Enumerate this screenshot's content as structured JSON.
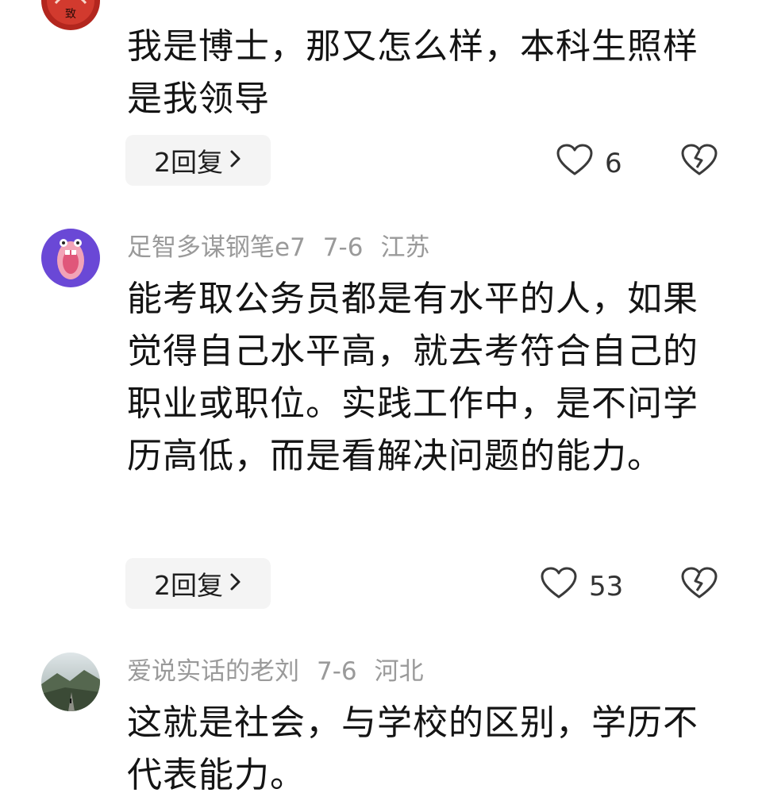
{
  "comments": [
    {
      "username": "",
      "date": "",
      "location": "",
      "text": "我是博士，那又怎么样，本科生照样是我领导",
      "reply_label": "2回复",
      "likes": "6"
    },
    {
      "username": "足智多谋钢笔e7",
      "date": "7-6",
      "location": "江苏",
      "text": "能考取公务员都是有水平的人，如果觉得自己水平高，就去考符合自己的职业或职位。实践工作中，是不问学历高低，而是看解决问题的能力。",
      "reply_label": "2回复",
      "likes": "53"
    },
    {
      "username": "爱说实话的老刘",
      "date": "7-6",
      "location": "河北",
      "text": "这就是社会，与学校的区别，学历不代表能力。"
    }
  ],
  "icons": {
    "like": "heart-outline-icon",
    "dislike": "broken-heart-icon",
    "chevron": "chevron-right-icon"
  },
  "colors": {
    "meta_gray": "#9a9a9a",
    "reply_bg": "#f4f4f4",
    "text": "#141414"
  }
}
